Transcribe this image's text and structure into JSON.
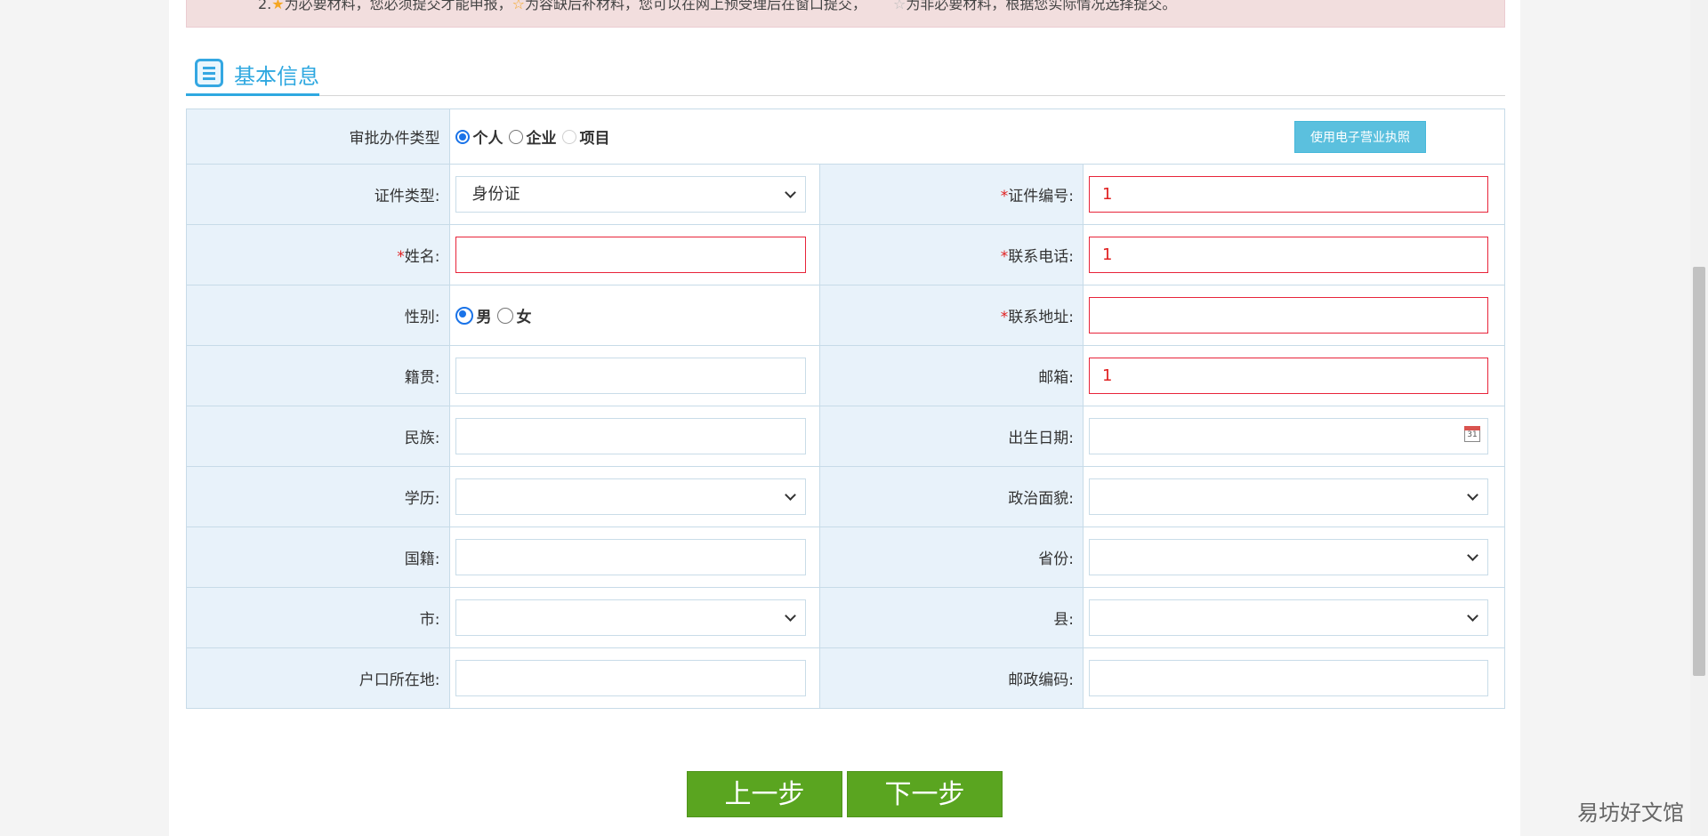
{
  "notice": {
    "prefix": "2.",
    "part1": "为必要材料，您必须提交才能申报，",
    "part2": "为容缺后补材料，您可以在网上预受理后在窗口提交，",
    "part3": "为非必要材料，根据您实际情况选择提交。"
  },
  "section": {
    "title": "基本信息"
  },
  "approval_type": {
    "label": "审批办件类型",
    "options": [
      "个人",
      "企业",
      "项目"
    ],
    "selected": "个人",
    "license_button": "使用电子营业执照"
  },
  "fields": {
    "cert_type": {
      "label": "证件类型:",
      "value": "身份证"
    },
    "cert_no": {
      "label": "证件编号:",
      "value": "1"
    },
    "name": {
      "label": "姓名:",
      "value": ""
    },
    "phone": {
      "label": "联系电话:",
      "value": "1"
    },
    "gender": {
      "label": "性别:",
      "options": [
        "男",
        "女"
      ],
      "selected": "男"
    },
    "address": {
      "label": "联系地址:",
      "value": ""
    },
    "native_place": {
      "label": "籍贯:",
      "value": ""
    },
    "email": {
      "label": "邮箱:",
      "value": "1"
    },
    "ethnicity": {
      "label": "民族:",
      "value": ""
    },
    "birth_date": {
      "label": "出生日期:",
      "value": ""
    },
    "education": {
      "label": "学历:",
      "value": ""
    },
    "political_status": {
      "label": "政治面貌:",
      "value": ""
    },
    "nationality": {
      "label": "国籍:",
      "value": ""
    },
    "province": {
      "label": "省份:",
      "value": ""
    },
    "city": {
      "label": "市:",
      "value": ""
    },
    "county": {
      "label": "县:",
      "value": ""
    },
    "household": {
      "label": "户口所在地:",
      "value": ""
    },
    "postcode": {
      "label": "邮政编码:",
      "value": ""
    }
  },
  "required_mark": "*",
  "calendar_day": "31",
  "buttons": {
    "prev": "上一步",
    "next": "下一步"
  },
  "watermark": "易坊好文馆",
  "colors": {
    "required": "#e02020",
    "accent": "#2fa8e0",
    "step_button": "#5aa520"
  }
}
